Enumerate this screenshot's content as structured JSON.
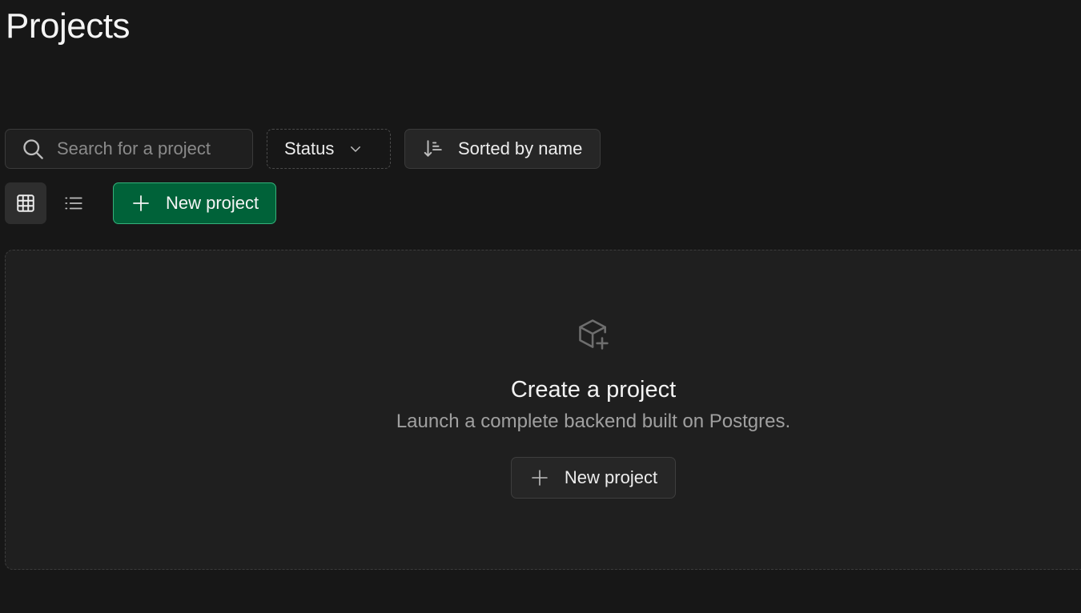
{
  "page": {
    "title": "Projects"
  },
  "toolbar": {
    "search": {
      "placeholder": "Search for a project",
      "value": "",
      "icon": "search-icon"
    },
    "status_filter": {
      "label": "Status",
      "icon": "chevron-down-icon"
    },
    "sort": {
      "label": "Sorted by name",
      "icon": "sort-icon"
    }
  },
  "view": {
    "grid_icon": "grid-icon",
    "list_icon": "list-icon",
    "active": "grid"
  },
  "actions": {
    "new_project_label": "New project",
    "new_project_icon": "plus-icon"
  },
  "empty_state": {
    "icon": "box-plus-icon",
    "title": "Create a project",
    "description": "Launch a complete backend built on Postgres.",
    "button_label": "New project"
  },
  "colors": {
    "background": "#171717",
    "panel": "#1f1f1f",
    "brand_green": "#006239",
    "brand_green_border": "#34b27b"
  }
}
